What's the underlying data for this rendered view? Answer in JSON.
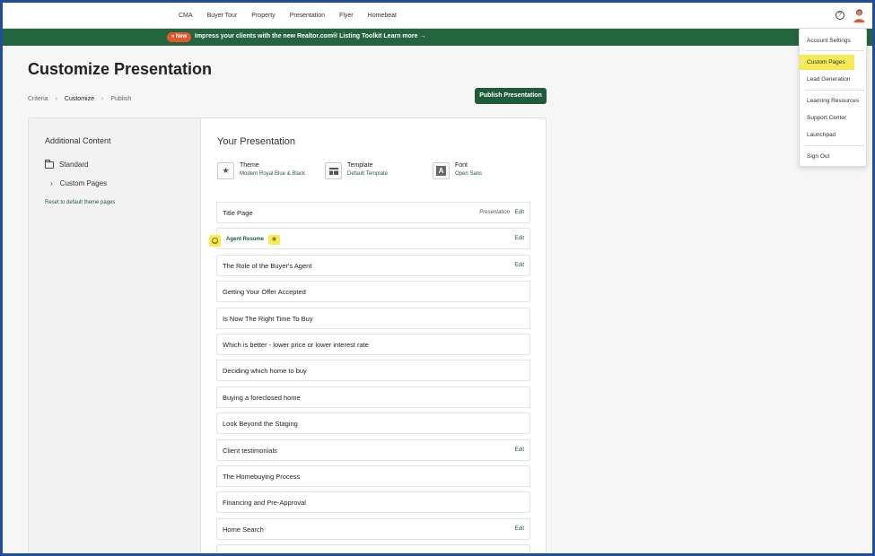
{
  "nav": {
    "links": [
      "CMA",
      "Buyer Tour",
      "Property",
      "Presentation",
      "Flyer",
      "Homebeat"
    ],
    "help_icon": "question-circle-icon"
  },
  "banner": {
    "pill": "» New",
    "text": "Impress your clients with the new Realtor.com® Listing Toolkit",
    "more": "Learn more →"
  },
  "page": {
    "title": "Customize Presentation",
    "breadcrumb": [
      "Criteria",
      "Customize",
      "Publish"
    ],
    "publish_label": "Publish Presentation"
  },
  "sidebar": {
    "heading": "Additional Content",
    "standard": "Standard",
    "custom": "Custom Pages",
    "reset": "Reset to default theme pages"
  },
  "presentation": {
    "heading": "Your Presentation",
    "settings": [
      {
        "label": "Theme",
        "value": "Modern Royal Blue & Black",
        "icon": "star-icon"
      },
      {
        "label": "Template",
        "value": "Default Template",
        "icon": "template-icon"
      },
      {
        "label": "Font",
        "value": "Open Sans",
        "icon": "font-icon"
      }
    ],
    "pages": [
      {
        "title": "Title Page",
        "tag": "Presentation",
        "edit": "Edit"
      },
      {
        "title": "Agent Resume",
        "tag": "",
        "edit": "Edit"
      },
      {
        "title": "The Role of the Buyer's Agent",
        "tag": "",
        "edit": "Edit"
      },
      {
        "title": "Getting Your Offer Accepted",
        "tag": "",
        "edit": ""
      },
      {
        "title": "Is Now The Right Time To Buy",
        "tag": "",
        "edit": ""
      },
      {
        "title": "Which is better - lower price or lower interest rate",
        "tag": "",
        "edit": ""
      },
      {
        "title": "Deciding which home to buy",
        "tag": "",
        "edit": ""
      },
      {
        "title": "Buying a foreclosed home",
        "tag": "",
        "edit": ""
      },
      {
        "title": "Look Beyond the Staging",
        "tag": "",
        "edit": ""
      },
      {
        "title": "Client testimonials",
        "tag": "",
        "edit": "Edit"
      },
      {
        "title": "The Homebuying Process",
        "tag": "",
        "edit": ""
      },
      {
        "title": "Financing and Pre-Approval",
        "tag": "",
        "edit": ""
      },
      {
        "title": "Home Search",
        "tag": "",
        "edit": "Edit"
      },
      {
        "title": "",
        "tag": "",
        "edit": ""
      }
    ]
  },
  "menu": {
    "items": [
      "Account Settings",
      "Custom Pages",
      "Lead Generation",
      "Learning Resources",
      "Support Center",
      "Launchpad",
      "Sign Out"
    ],
    "highlight_color": "#f7ea58"
  },
  "colors": {
    "brand_green": "#1e5c3a",
    "banner_green": "#24643f",
    "new_pill": "#e4572e",
    "frame_blue": "#1f4e9c"
  }
}
